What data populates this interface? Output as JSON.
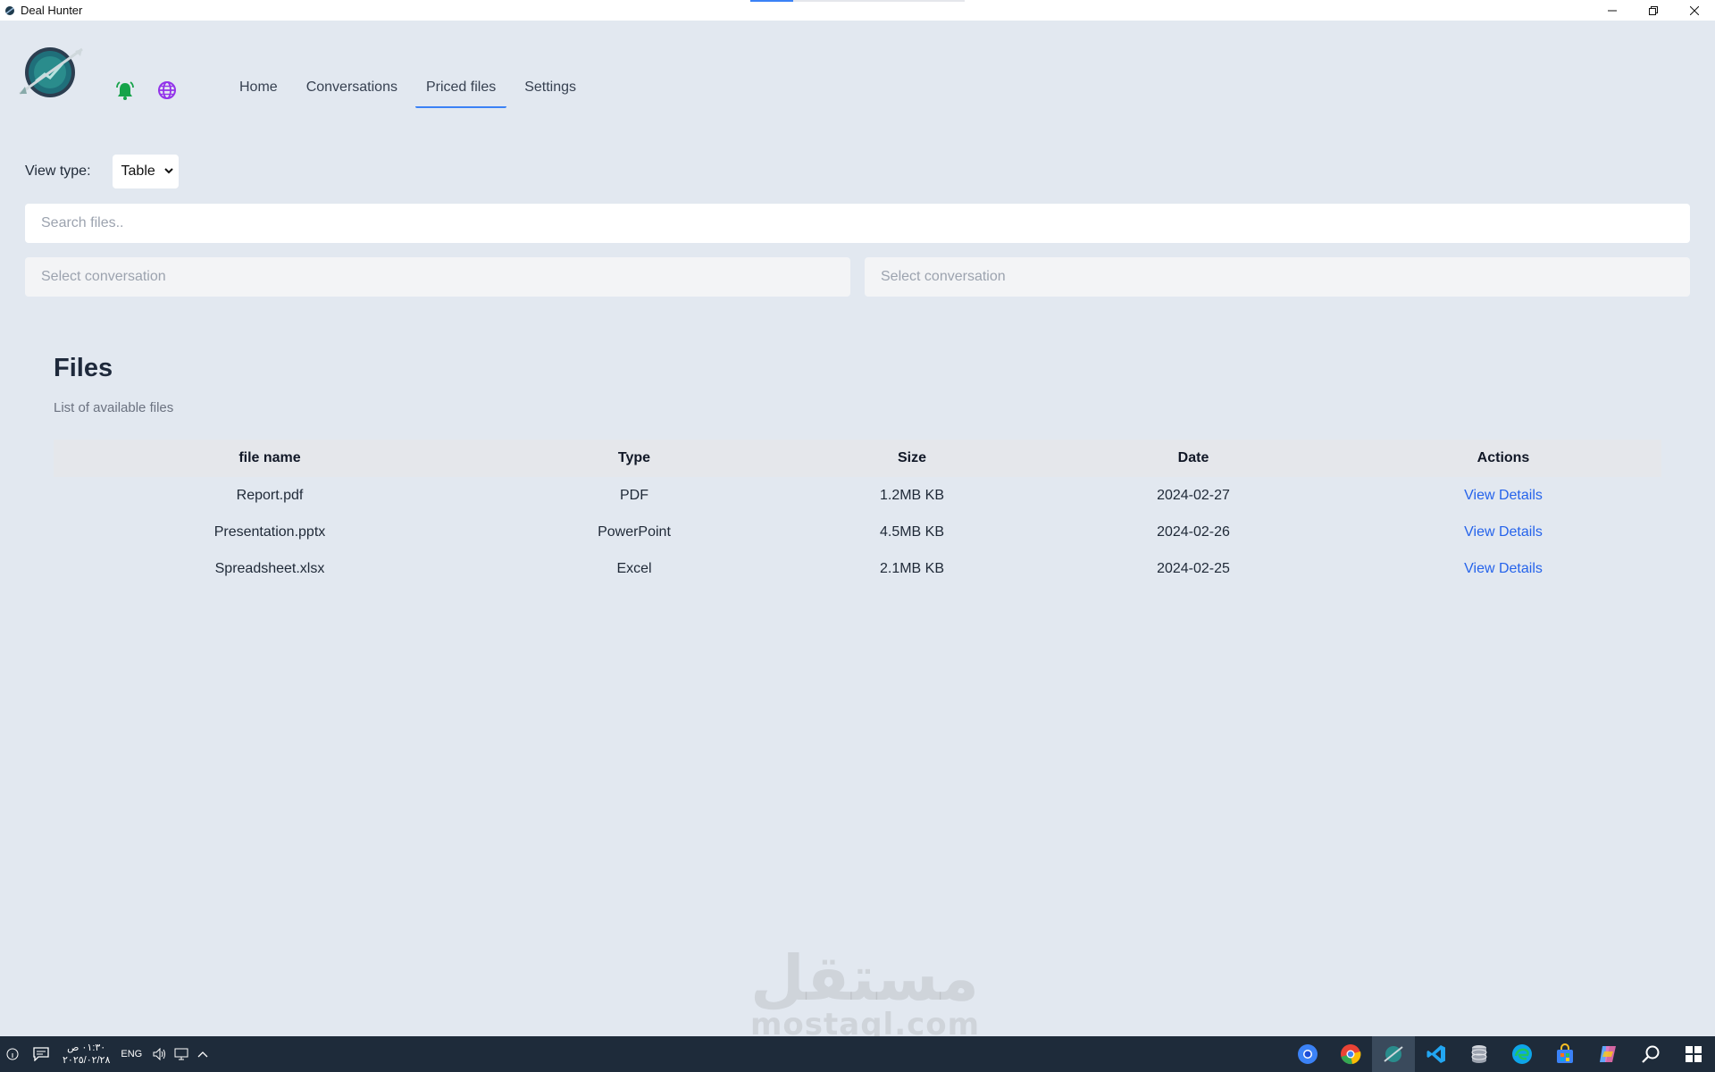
{
  "window": {
    "title": "Deal Hunter"
  },
  "nav": {
    "links": [
      "Home",
      "Conversations",
      "Priced files",
      "Settings"
    ],
    "active_index": 2
  },
  "view_type": {
    "label": "View type:",
    "selected": "Table"
  },
  "search": {
    "placeholder": "Search files.."
  },
  "filters": [
    {
      "placeholder": "Select conversation"
    },
    {
      "placeholder": "Select conversation"
    }
  ],
  "files": {
    "title": "Files",
    "subtitle": "List of available files",
    "columns": [
      "file name",
      "Type",
      "Size",
      "Date",
      "Actions"
    ],
    "rows": [
      {
        "name": "Report.pdf",
        "type": "PDF",
        "size": "1.2MB KB",
        "date": "2024-02-27",
        "action": "View Details"
      },
      {
        "name": "Presentation.pptx",
        "type": "PowerPoint",
        "size": "4.5MB KB",
        "date": "2024-02-26",
        "action": "View Details"
      },
      {
        "name": "Spreadsheet.xlsx",
        "type": "Excel",
        "size": "2.1MB KB",
        "date": "2024-02-25",
        "action": "View Details"
      }
    ]
  },
  "watermark": {
    "arabic": "مستقل",
    "latin": "mostaql.com"
  },
  "taskbar": {
    "time": "٠١:٣٠ ص",
    "date": "٢٠٢٥/٠٢/٢٨",
    "language": "ENG",
    "apps": [
      "chrome-icon",
      "chrome-alt-icon",
      "deal-hunter-icon",
      "vscode-icon",
      "database-icon",
      "edge-icon",
      "store-icon",
      "copilot-icon",
      "search-icon",
      "windows-start-icon"
    ]
  },
  "colors": {
    "background": "#e2e8f0",
    "accent": "#3b82f6",
    "link": "#2563eb",
    "bell": "#16a34a",
    "globe": "#9333ea",
    "taskbar": "#1e2b3a"
  }
}
